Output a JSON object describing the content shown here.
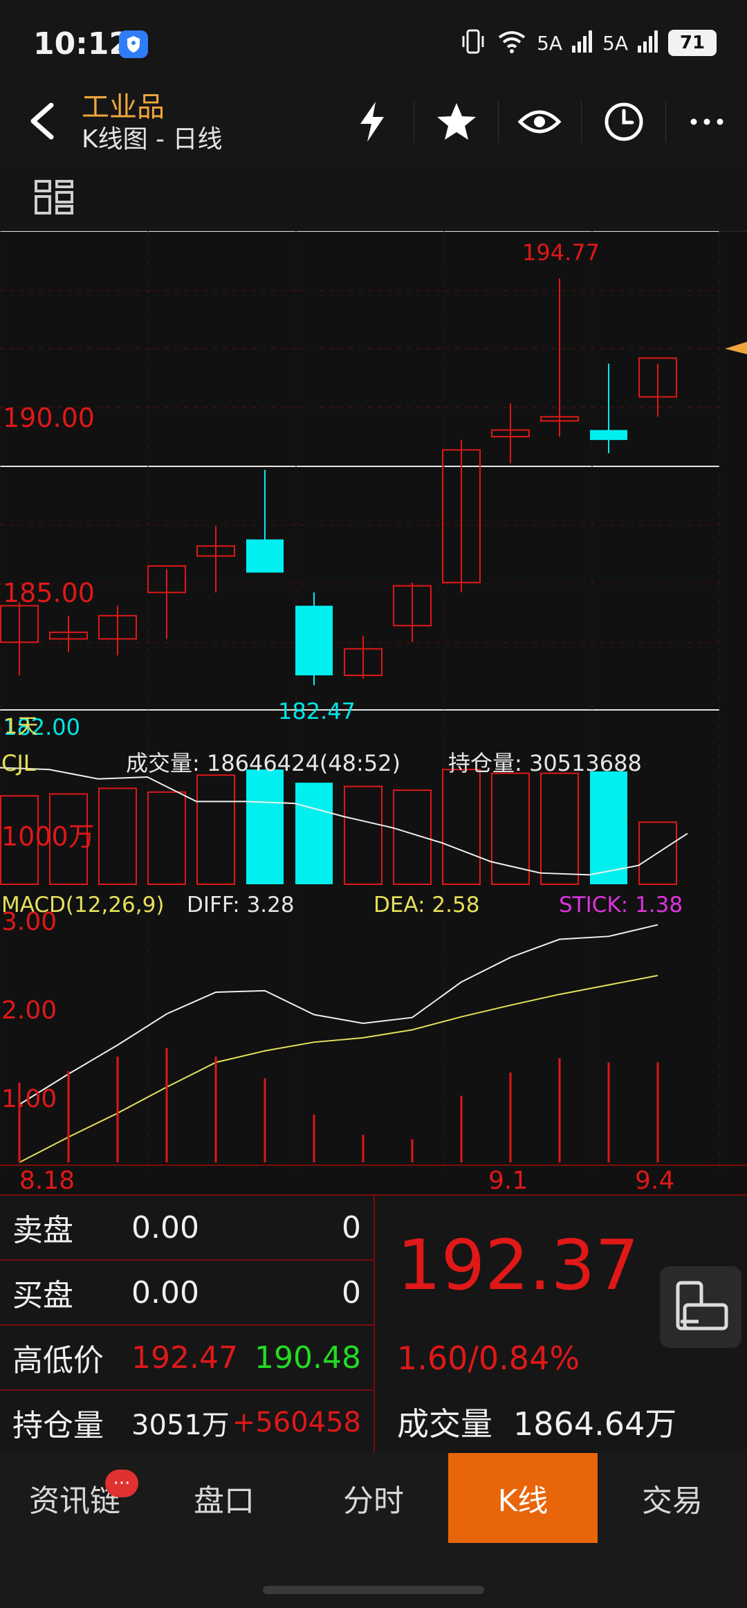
{
  "status": {
    "time": "10:12",
    "signal1": "5A",
    "signal2": "5A",
    "battery": "71"
  },
  "header": {
    "title": "工业品",
    "subtitle": "K线图 - 日线"
  },
  "chart_labels": {
    "price_top": "194.77",
    "price_bottom": "182.47",
    "y190": "190.00",
    "y185": "185.00",
    "y_low": "182.00",
    "overlap": "1天",
    "cjl": "CJL",
    "volume": "成交量: 18646424(48:52)",
    "open_interest": "持仓量: 30513688",
    "vol_axis": "1000万",
    "macd": "MACD(12,26,9)",
    "diff": "DIFF: 3.28",
    "dea": "DEA: 2.58",
    "stick": "STICK: 1.38",
    "m3": "3.00",
    "m2": "2.00",
    "m1": "1.00",
    "d1": "8.18",
    "d2": "9.1",
    "d3": "9.4"
  },
  "chart_data": {
    "type": "candlestick",
    "price_ylim": [
      181.8,
      196.2
    ],
    "candles": [
      {
        "o": 183.8,
        "h": 185.0,
        "l": 182.8,
        "c": 184.9,
        "color": "red"
      },
      {
        "o": 183.9,
        "h": 184.6,
        "l": 183.5,
        "c": 184.1,
        "color": "red"
      },
      {
        "o": 183.9,
        "h": 184.9,
        "l": 183.4,
        "c": 184.6,
        "color": "red"
      },
      {
        "o": 185.3,
        "h": 186.0,
        "l": 183.9,
        "c": 186.1,
        "color": "red"
      },
      {
        "o": 186.4,
        "h": 187.3,
        "l": 185.3,
        "c": 186.7,
        "color": "red"
      },
      {
        "o": 186.9,
        "h": 189.0,
        "l": 185.9,
        "c": 185.9,
        "color": "cyan"
      },
      {
        "o": 184.9,
        "h": 185.3,
        "l": 182.5,
        "c": 182.8,
        "color": "cyan"
      },
      {
        "o": 182.8,
        "h": 184.0,
        "l": 182.7,
        "c": 183.6,
        "color": "red"
      },
      {
        "o": 184.3,
        "h": 185.6,
        "l": 183.8,
        "c": 185.5,
        "color": "red"
      },
      {
        "o": 185.6,
        "h": 189.9,
        "l": 185.3,
        "c": 189.6,
        "color": "red"
      },
      {
        "o": 190.0,
        "h": 191.0,
        "l": 189.2,
        "c": 190.2,
        "color": "red"
      },
      {
        "o": 190.5,
        "h": 194.77,
        "l": 190.0,
        "c": 190.6,
        "color": "red"
      },
      {
        "o": 190.2,
        "h": 192.2,
        "l": 189.5,
        "c": 189.9,
        "color": "cyan"
      },
      {
        "o": 191.2,
        "h": 192.2,
        "l": 190.6,
        "c": 192.37,
        "color": "red"
      }
    ],
    "volume_ylim": [
      0,
      3200
    ],
    "volumes": [
      {
        "v": 2350,
        "color": "red"
      },
      {
        "v": 2400,
        "color": "red"
      },
      {
        "v": 2550,
        "color": "red"
      },
      {
        "v": 2450,
        "color": "red"
      },
      {
        "v": 2900,
        "color": "red"
      },
      {
        "v": 3050,
        "color": "cyan"
      },
      {
        "v": 2700,
        "color": "cyan"
      },
      {
        "v": 2600,
        "color": "red"
      },
      {
        "v": 2500,
        "color": "red"
      },
      {
        "v": 3050,
        "color": "red"
      },
      {
        "v": 2950,
        "color": "red"
      },
      {
        "v": 2950,
        "color": "red"
      },
      {
        "v": 3000,
        "color": "cyan"
      },
      {
        "v": 1650,
        "color": "red"
      }
    ],
    "volume_ma": [
      3100,
      3050,
      2800,
      2850,
      2200,
      2200,
      2150,
      1800,
      1500,
      1100,
      600,
      300,
      250,
      500,
      1350
    ],
    "macd_ylim": [
      0.0,
      3.4
    ],
    "diff": [
      0.8,
      1.22,
      1.62,
      2.05,
      2.35,
      2.37,
      2.04,
      1.92,
      2.0,
      2.49,
      2.83,
      3.08,
      3.12,
      3.28
    ],
    "dea": [
      0.0,
      0.35,
      0.68,
      1.04,
      1.38,
      1.54,
      1.66,
      1.72,
      1.83,
      2.01,
      2.17,
      2.32,
      2.45,
      2.58
    ],
    "stick": [
      1.1,
      1.26,
      1.46,
      1.58,
      1.46,
      1.16,
      0.66,
      0.38,
      0.32,
      0.92,
      1.24,
      1.44,
      1.38,
      1.38
    ]
  },
  "panel": {
    "sell_label": "卖盘",
    "sell_price": "0.00",
    "sell_qty": "0",
    "buy_label": "买盘",
    "buy_price": "0.00",
    "buy_qty": "0",
    "hl_label": "高低价",
    "high": "192.47",
    "low": "190.48",
    "oi_label": "持仓量",
    "oi_value": "3051万",
    "oi_change": "+560458",
    "price": "192.37",
    "change": "1.60/0.84%",
    "vol_label": "成交量",
    "vol_value": "1864.64万"
  },
  "nav": {
    "tab1": "资讯链",
    "badge": "···",
    "tab2": "盘口",
    "tab3": "分时",
    "tab4": "K线",
    "tab5": "交易"
  },
  "colors": {
    "up": "#e01818",
    "down": "#00f0f0",
    "accent": "#e8650a",
    "title": "#f0a63c",
    "dea": "#e5e05a",
    "stick": "#dd33dd"
  }
}
